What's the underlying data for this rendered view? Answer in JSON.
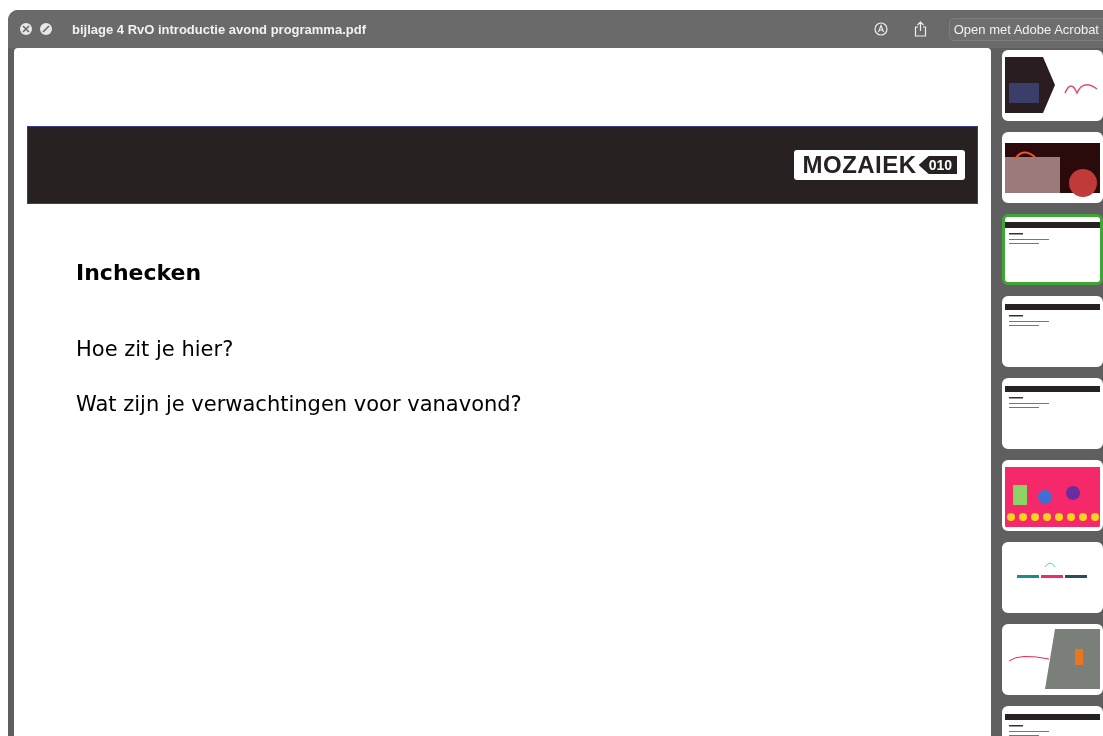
{
  "window": {
    "title": "bijlage 4 RvO introductie avond programma.pdf",
    "open_button": "Open met Adobe Acrobat"
  },
  "slide": {
    "logo": {
      "name": "MOZAIEK",
      "badge": "010"
    },
    "heading": "Inchecken",
    "lines": [
      "Hoe zit je hier?",
      "Wat zijn je verwachtingen voor vanavond?"
    ]
  },
  "thumbnails": [
    {
      "kind": "welcome",
      "selected": false
    },
    {
      "kind": "stage",
      "selected": false
    },
    {
      "kind": "text",
      "selected": true
    },
    {
      "kind": "text",
      "selected": false
    },
    {
      "kind": "text",
      "selected": false
    },
    {
      "kind": "pink",
      "selected": false
    },
    {
      "kind": "vision",
      "selected": false
    },
    {
      "kind": "photo-side",
      "selected": false
    },
    {
      "kind": "text",
      "selected": false
    }
  ]
}
